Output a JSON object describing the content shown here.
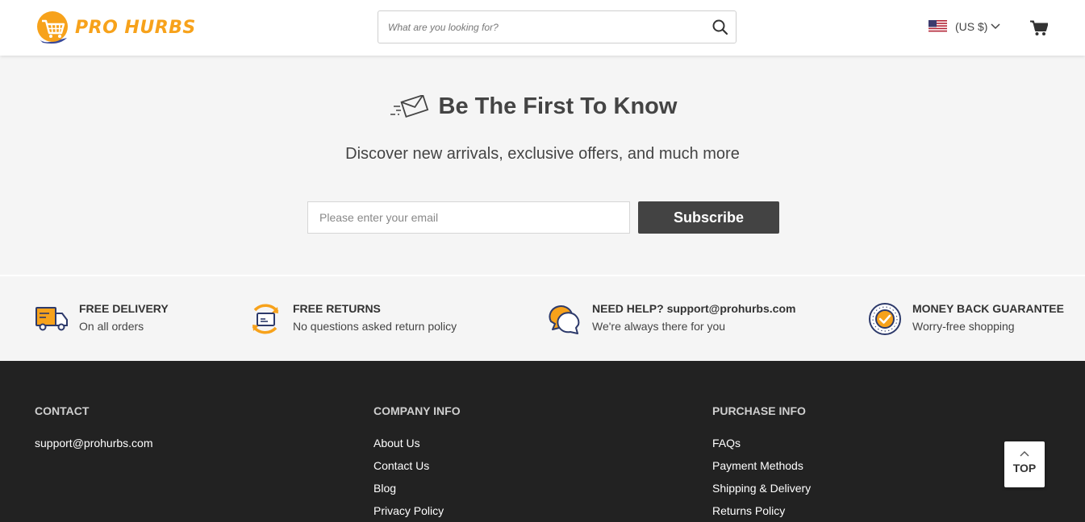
{
  "header": {
    "logo_text": "PRO HURBS",
    "search_placeholder": "What are you looking for?",
    "currency_label": "(US $)",
    "icons": {
      "search": "search-icon",
      "cart": "cart-icon",
      "flag": "us-flag-icon",
      "chevron": "chevron-down-icon"
    }
  },
  "newsletter": {
    "title": "Be The First To Know",
    "subtitle": "Discover new arrivals, exclusive offers, and much more",
    "email_placeholder": "Please enter your email",
    "subscribe_label": "Subscribe"
  },
  "features": [
    {
      "title": "FREE DELIVERY",
      "subtitle": "On all orders",
      "icon": "delivery-truck-icon"
    },
    {
      "title": "FREE RETURNS",
      "subtitle": "No questions asked return policy",
      "icon": "returns-icon"
    },
    {
      "title": "NEED HELP? support@prohurbs.com",
      "subtitle": "We're always there for you",
      "icon": "chat-bubbles-icon"
    },
    {
      "title": "MONEY BACK GUARANTEE",
      "subtitle": "Worry-free shopping",
      "icon": "guarantee-badge-icon"
    }
  ],
  "footer": {
    "contact": {
      "heading": "CONTACT",
      "email": "support@prohurbs.com"
    },
    "company": {
      "heading": "COMPANY INFO",
      "links": [
        "About Us",
        "Contact Us",
        "Blog",
        "Privacy Policy"
      ]
    },
    "purchase": {
      "heading": "PURCHASE INFO",
      "links": [
        "FAQs",
        "Payment Methods",
        "Shipping & Delivery",
        "Returns Policy"
      ]
    }
  },
  "top_button": {
    "label": "TOP"
  },
  "colors": {
    "brand_orange": "#f7a21b",
    "brand_blue": "#3a4a9a",
    "dark_button": "#434343",
    "footer_bg": "#222222",
    "page_bg": "#f5f5f5"
  }
}
